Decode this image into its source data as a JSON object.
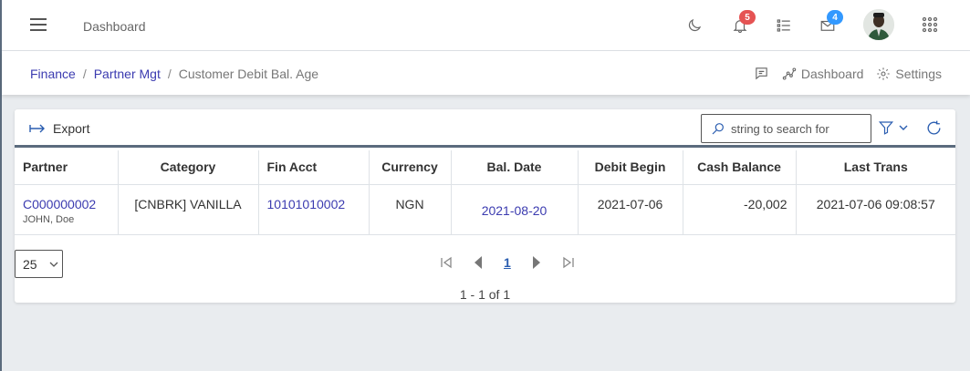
{
  "header": {
    "title": "Dashboard",
    "notifications_count": "5",
    "messages_count": "4",
    "colors": {
      "notify_badge": "#e55353",
      "message_badge": "#3399ff"
    }
  },
  "breadcrumb": {
    "items": [
      "Finance",
      "Partner Mgt"
    ],
    "current": "Customer Debit Bal. Age"
  },
  "subbar": {
    "dashboard_label": "Dashboard",
    "settings_label": "Settings"
  },
  "toolbar": {
    "export_label": "Export",
    "search_placeholder": "string to search for"
  },
  "table": {
    "columns": [
      "Partner",
      "Category",
      "Fin Acct",
      "Currency",
      "Bal. Date",
      "Debit Begin",
      "Cash Balance",
      "Last Trans"
    ],
    "rows": [
      {
        "partner_code": "C000000002",
        "partner_name": "JOHN, Doe",
        "category": "[CNBRK] VANILLA",
        "fin_acct": "10101010002",
        "currency": "NGN",
        "bal_date": "2021-08-20",
        "debit_begin": "2021-07-06",
        "cash_balance": "-20,002",
        "last_trans": "2021-07-06 09:08:57"
      }
    ]
  },
  "pager": {
    "page_size": "25",
    "current_page": "1",
    "range_text": "1 - 1 of 1"
  }
}
